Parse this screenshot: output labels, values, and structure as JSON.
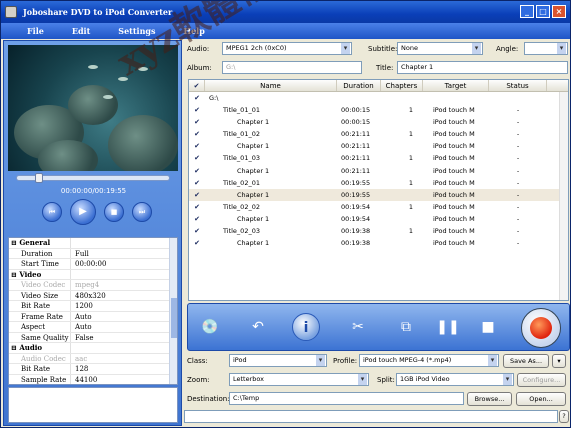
{
  "window": {
    "title": "Joboshare DVD to iPod Converter",
    "controls": [
      "_",
      "□",
      "×"
    ]
  },
  "menu": [
    "File",
    "Edit",
    "Settings",
    "Help"
  ],
  "player": {
    "time": "00:00:00/00:19:55",
    "progress": 0.12,
    "buttons": [
      {
        "name": "previous-button",
        "glyph": "⏮"
      },
      {
        "name": "play-button",
        "glyph": "▶"
      },
      {
        "name": "stop-button",
        "glyph": "■"
      },
      {
        "name": "next-button",
        "glyph": "⏭"
      }
    ]
  },
  "properties": [
    {
      "type": "group",
      "key": "General",
      "value": ""
    },
    {
      "type": "item",
      "key": "Duration",
      "value": "Full"
    },
    {
      "type": "item",
      "key": "Start Time",
      "value": "00:00:00"
    },
    {
      "type": "group",
      "key": "Video",
      "value": ""
    },
    {
      "type": "disabled",
      "key": "Video Codec",
      "value": "mpeg4"
    },
    {
      "type": "item",
      "key": "Video Size",
      "value": "480x320"
    },
    {
      "type": "item",
      "key": "Bit Rate",
      "value": "1200"
    },
    {
      "type": "item",
      "key": "Frame Rate",
      "value": "Auto"
    },
    {
      "type": "item",
      "key": "Aspect",
      "value": "Auto"
    },
    {
      "type": "item",
      "key": "Same Quality",
      "value": "False"
    },
    {
      "type": "group",
      "key": "Audio",
      "value": ""
    },
    {
      "type": "disabled",
      "key": "Audio Codec",
      "value": "aac"
    },
    {
      "type": "item",
      "key": "Bit Rate",
      "value": "128"
    },
    {
      "type": "item",
      "key": "Sample Rate",
      "value": "44100"
    }
  ],
  "top_form": {
    "audio_label": "Audio:",
    "audio_value": "MPEG1 2ch (0xC0)",
    "subtitle_label": "Subtitle:",
    "subtitle_value": "None",
    "angle_label": "Angle:",
    "album_label": "Album:",
    "album_value": "G:\\",
    "title_label": "Title:",
    "title_value": "Chapter 1"
  },
  "list": {
    "headers": [
      "",
      "Name",
      "Duration",
      "Chapters",
      "Target",
      "Status"
    ],
    "rows": [
      {
        "indent": 0,
        "name": "G:\\",
        "duration": "",
        "chapters": "",
        "target": "",
        "status": "",
        "selected": false
      },
      {
        "indent": 1,
        "name": "Title_01_01",
        "duration": "00:00:15",
        "chapters": "1",
        "target": "iPod touch M",
        "status": "-",
        "selected": false
      },
      {
        "indent": 2,
        "name": "Chapter 1",
        "duration": "00:00:15",
        "chapters": "",
        "target": "iPod touch M",
        "status": "-",
        "selected": false
      },
      {
        "indent": 1,
        "name": "Title_01_02",
        "duration": "00:21:11",
        "chapters": "1",
        "target": "iPod touch M",
        "status": "-",
        "selected": false
      },
      {
        "indent": 2,
        "name": "Chapter 1",
        "duration": "00:21:11",
        "chapters": "",
        "target": "iPod touch M",
        "status": "-",
        "selected": false
      },
      {
        "indent": 1,
        "name": "Title_01_03",
        "duration": "00:21:11",
        "chapters": "1",
        "target": "iPod touch M",
        "status": "-",
        "selected": false
      },
      {
        "indent": 2,
        "name": "Chapter 1",
        "duration": "00:21:11",
        "chapters": "",
        "target": "iPod touch M",
        "status": "-",
        "selected": false
      },
      {
        "indent": 1,
        "name": "Title_02_01",
        "duration": "00:19:55",
        "chapters": "1",
        "target": "iPod touch M",
        "status": "-",
        "selected": false
      },
      {
        "indent": 2,
        "name": "Chapter 1",
        "duration": "00:19:55",
        "chapters": "",
        "target": "iPod touch M",
        "status": "-",
        "selected": true
      },
      {
        "indent": 1,
        "name": "Title_02_02",
        "duration": "00:19:54",
        "chapters": "1",
        "target": "iPod touch M",
        "status": "-",
        "selected": false
      },
      {
        "indent": 2,
        "name": "Chapter 1",
        "duration": "00:19:54",
        "chapters": "",
        "target": "iPod touch M",
        "status": "-",
        "selected": false
      },
      {
        "indent": 1,
        "name": "Title_02_03",
        "duration": "00:19:38",
        "chapters": "1",
        "target": "iPod touch M",
        "status": "-",
        "selected": false
      },
      {
        "indent": 2,
        "name": "Chapter 1",
        "duration": "00:19:38",
        "chapters": "",
        "target": "iPod touch M",
        "status": "-",
        "selected": false
      }
    ]
  },
  "toolbar": [
    {
      "name": "load-dvd-button",
      "glyph": "💿",
      "round": false
    },
    {
      "name": "load-ifo-button",
      "glyph": "↶",
      "round": false
    },
    {
      "name": "info-button",
      "glyph": "i",
      "round": true
    },
    {
      "name": "clip-button",
      "glyph": "✂",
      "round": false
    },
    {
      "name": "snapshot-button",
      "glyph": "⧉",
      "round": false
    },
    {
      "name": "pause-button",
      "glyph": "❚❚",
      "round": false
    },
    {
      "name": "stop-convert-button",
      "glyph": "■",
      "round": false
    }
  ],
  "bottom_form": {
    "class_label": "Class:",
    "class_value": "iPod",
    "profile_label": "Profile:",
    "profile_value": "iPod touch MPEG-4  (*.mp4)",
    "save_as": "Save As...",
    "zoom_label": "Zoom:",
    "zoom_value": "Letterbox",
    "split_label": "Split:",
    "split_value": "1GB iPod Video",
    "configure": "Configure...",
    "destination_label": "Destination:",
    "destination_value": "C:\\Temp",
    "browse": "Browse...",
    "open": "Open...",
    "help_glyph": "?"
  },
  "watermark": "xyz軟體補給站 http://31.to"
}
